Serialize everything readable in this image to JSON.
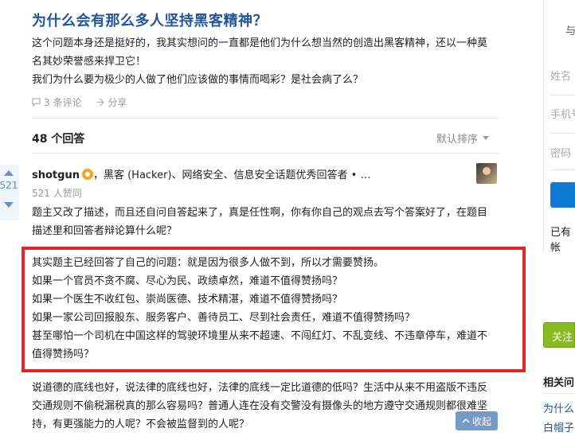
{
  "question": {
    "title": "为什么会有那么多人坚持黑客精神？",
    "body_lines": [
      "这个问题本身还是挺好的，我其实想问的一直都是他们为什么想当然的创造出黑客精神，还以一种莫",
      "名其妙荣誉感来捍卫它！",
      "我们为什么要为极少的人做了他们应该做的事情而喝彩？是社会病了么？"
    ],
    "comments_label": "3 条评论",
    "share_label": "分享"
  },
  "answers_header": {
    "count_label": "48 个回答",
    "sort_label": "默认排序"
  },
  "answer": {
    "vote_count": "521",
    "author_name": "shotgun",
    "author_bio": "，黑客 (Hacker)、网络安全、信息安全话题优秀回答者 • …",
    "votes_text": "521 人赞同",
    "para1_lines": [
      "题主又改了描述，而且还自问自答起来了，真是任性啊，你有你自己的观点去写个答案好了，在题目",
      "描述里和回答者辩论算什么呢？"
    ],
    "para2_lines": [
      "其实题主已经回答了自己的问题：就是因为很多人做不到，所以才需要赞扬。",
      "如果一个官员不贪不腐、尽心为民、政绩卓然，难道不值得赞扬吗？",
      "如果一个医生不收红包、崇尚医德、技术精湛，难道不值得赞扬吗？",
      "如果一家公司回报股东、服务客户、善待员工、尽到社会责任，难道不值得赞扬吗？",
      "甚至哪怕一个司机在中国这样的驾驶环境里从来不超速、不闯红灯、不乱变线、不违章停车，难道不",
      "值得赞扬吗？"
    ],
    "para3_lines": [
      "说道德的底线也好，说法律的底线也好，法律的底线一定比道德的低吗？生活中从来不用盗版不违反",
      "交通规则不偷税漏税真的那么容易吗？普通人连在没有交警没有摄像头的地方遵守交通规则都很难坚",
      "持，有更强能力的人呢？不会被监督到的人呢？"
    ],
    "collapse_label": "收起"
  },
  "sidebar": {
    "top_text": "与",
    "name_field": "姓名",
    "phone_field": "手机号",
    "password_field": "密码",
    "account_text": "已有帐",
    "follow_label": "关注",
    "related_title": "相关问",
    "related_links": [
      "为什么",
      "白帽子"
    ]
  },
  "colors": {
    "title_blue": "#225599",
    "accent_blue": "#698ebf",
    "highlight_red": "#e8232a",
    "follow_green": "#8ab923"
  }
}
